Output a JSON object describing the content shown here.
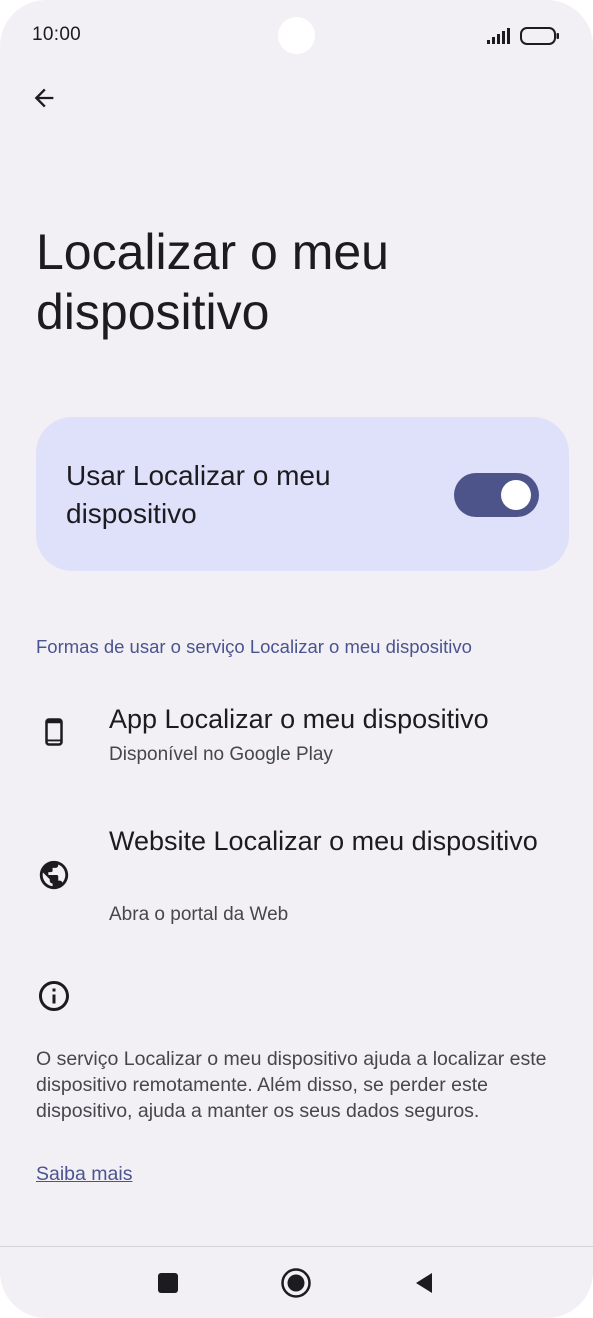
{
  "status_bar": {
    "time": "10:00"
  },
  "header": {
    "back_icon": "arrow-back-icon"
  },
  "page": {
    "title": "Localizar o meu dispositivo"
  },
  "toggle_card": {
    "label": "Usar Localizar o meu dispositivo",
    "enabled": true,
    "card_color": "#dfe0fa",
    "switch_color": "#4d5489"
  },
  "section": {
    "header": "Formas de usar o serviço Localizar o meu dispositivo"
  },
  "list": [
    {
      "icon": "phone-device-icon",
      "title": "App Localizar o meu dispositivo",
      "subtitle": "Disponível no Google Play"
    },
    {
      "icon": "globe-icon",
      "title": "Website Localizar o meu dispositivo",
      "subtitle": "Abra o portal da Web"
    }
  ],
  "info": {
    "icon": "info-icon",
    "text": "O serviço Localizar o meu dispositivo ajuda a localizar este dispositivo remotamente. Além disso, se perder este dispositivo, ajuda a manter os seus dados seguros.",
    "link": "Saiba mais"
  },
  "nav_bar": {
    "buttons": [
      "recents-square-icon",
      "home-circle-icon",
      "back-triangle-icon"
    ]
  },
  "colors": {
    "background": "#f2f0f4",
    "accent": "#4a5490"
  }
}
